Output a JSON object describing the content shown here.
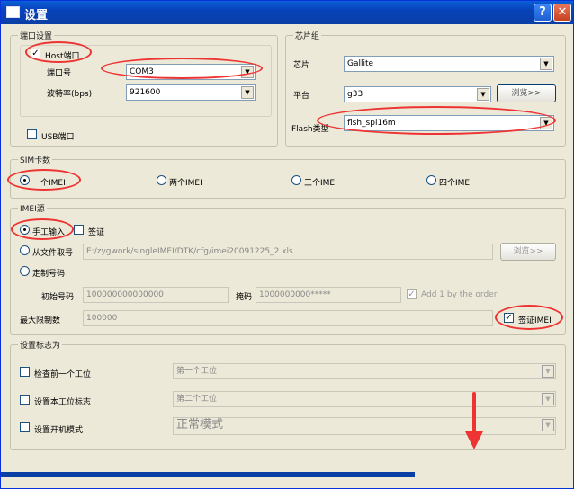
{
  "window": {
    "title": "设置",
    "help_label": "?",
    "close_label": "✕"
  },
  "port_group": {
    "legend": "端口设置",
    "host_checkbox": {
      "label": "Host端口",
      "checked": true
    },
    "port_label": "端口号",
    "port_value": "COM3",
    "baud_label": "波特率(bps)",
    "baud_value": "921600",
    "usb_checkbox": {
      "label": "USB端口",
      "checked": false
    }
  },
  "chip_group": {
    "legend": "芯片组",
    "chip_label": "芯片",
    "chip_value": "Gallite",
    "platform_label": "平台",
    "platform_value": "g33",
    "browse_label": "浏览>>",
    "flash_label": "Flash类型",
    "flash_value": "flsh_spi16m"
  },
  "sim_group": {
    "legend": "SIM卡数",
    "options": [
      "一个IMEI",
      "两个IMEI",
      "三个IMEI",
      "四个IMEI"
    ],
    "selected": "一个IMEI"
  },
  "imei_group": {
    "legend": "IMEI源",
    "manual_label": "手工输入",
    "sign_label": "签证",
    "file_label": "从文件取号",
    "file_path": "E:/zygwork/singleIMEI/DTK/cfg/imei20091225_2.xls",
    "browse_label": "浏览>>",
    "custom_label": "定制号码",
    "start_label": "初始号码",
    "start_value": "100000000000000",
    "mask_label": "掩码",
    "mask_value": "1000000000*****",
    "add_one_label": "Add 1 by the order",
    "max_label": "最大限制数",
    "max_value": "100000",
    "sign_imei_label": "签证IMEI"
  },
  "flag_group": {
    "legend": "设置标志为",
    "rows": [
      {
        "label": "检查前一个工位",
        "value": "第一个工位"
      },
      {
        "label": "设置本工位标志",
        "value": "第二个工位"
      },
      {
        "label": "设置开机模式",
        "value": "正常模式"
      }
    ]
  },
  "colors": {
    "highlight": "#e33333",
    "titlebar": "#0842b8"
  },
  "icons": {
    "arrow": "red-down-arrow-icon",
    "dropdown": "chevron-down-icon"
  }
}
